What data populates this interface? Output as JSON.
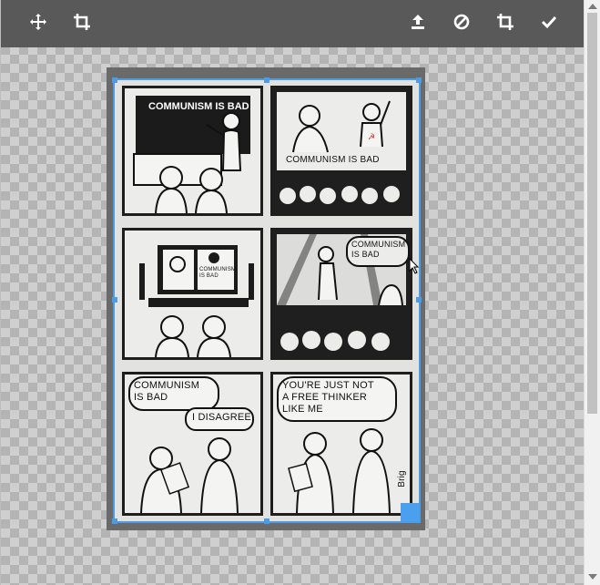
{
  "toolbar": {
    "move_icon": "move-icon",
    "crop_icon": "crop-icon",
    "upload_icon": "upload-icon",
    "cancel_icon": "cancel-icon",
    "crop_apply_icon": "crop-icon",
    "confirm_icon": "check-icon",
    "background": "#595959",
    "icon_color": "#ffffff"
  },
  "editor": {
    "accent": "#4d9be3",
    "handle_color": "#4aa0ee"
  },
  "comic": {
    "panel1_board": "COMMUNISM\nIS BAD",
    "panel2_caption": "COMMUNISM IS BAD",
    "panel3_screen": "COMMUNISM\nIS BAD",
    "panel4_bubble": "COMMUNISM\nIS BAD",
    "panel5_bubble1": "COMMUNISM\nIS BAD",
    "panel5_bubble2": "I DISAGREE",
    "panel6_bubble": "YOU'RE JUST NOT\nA FREE THINKER\nLIKE ME",
    "signature": "Brig"
  }
}
